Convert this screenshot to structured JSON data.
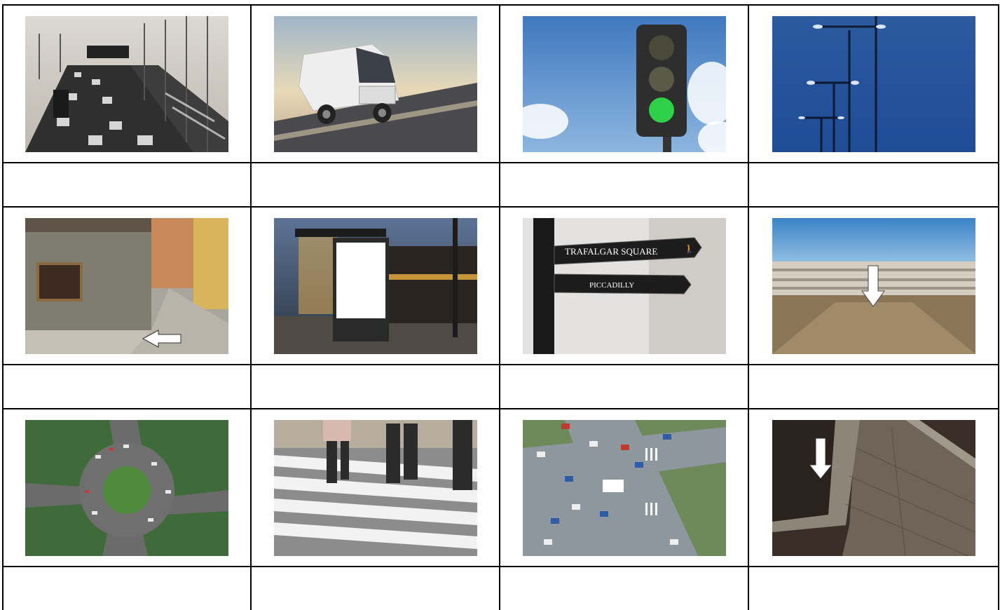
{
  "worksheet": {
    "pictures": [
      {
        "name": "motorway-traffic",
        "caption": ""
      },
      {
        "name": "delivery-van",
        "caption": ""
      },
      {
        "name": "traffic-light",
        "caption": ""
      },
      {
        "name": "street-lamps",
        "caption": ""
      },
      {
        "name": "street-corner",
        "caption": ""
      },
      {
        "name": "bus-shelter",
        "caption": ""
      },
      {
        "name": "signpost",
        "caption": ""
      },
      {
        "name": "square",
        "caption": ""
      },
      {
        "name": "roundabout",
        "caption": ""
      },
      {
        "name": "crossing",
        "caption": ""
      },
      {
        "name": "crossroads",
        "caption": ""
      },
      {
        "name": "pavement",
        "caption": ""
      }
    ],
    "signpost_top": "TRAFALGAR SQUARE",
    "signpost_bottom": "PICCADILLY"
  }
}
